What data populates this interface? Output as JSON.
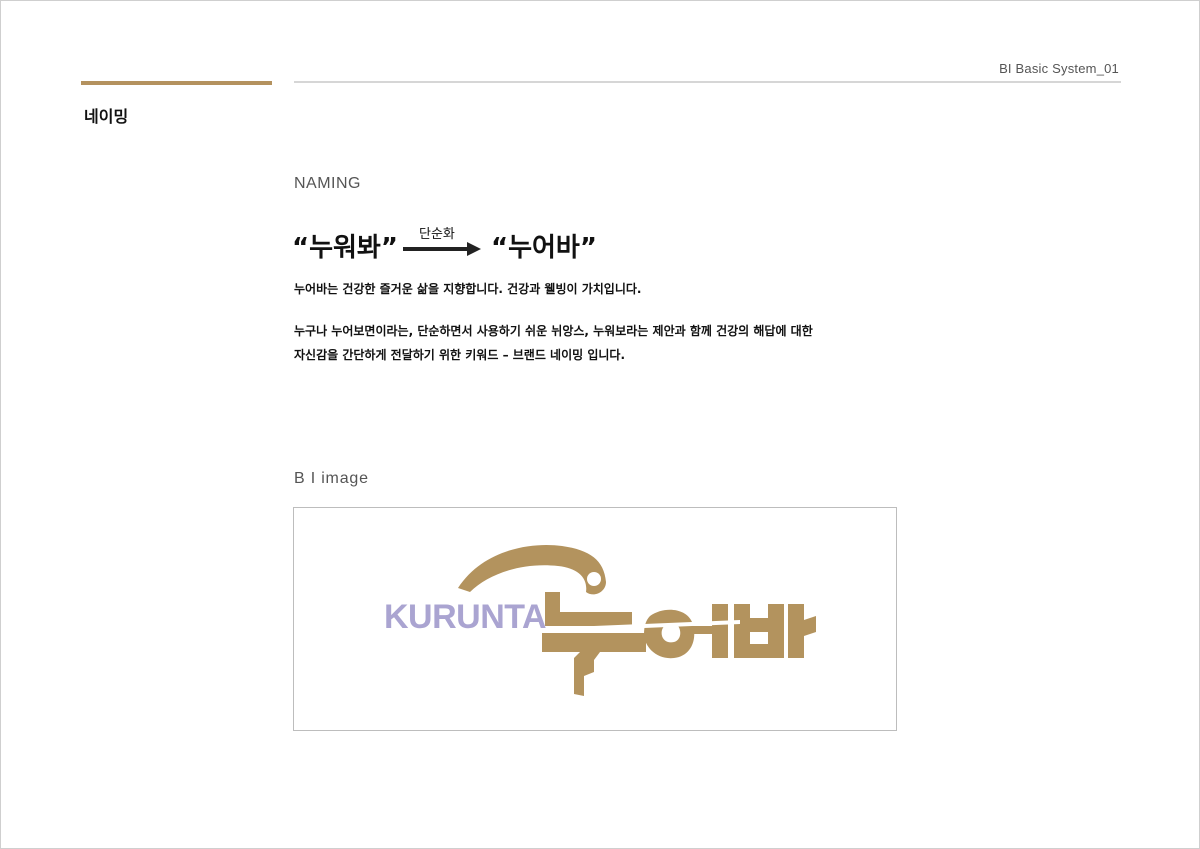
{
  "header": {
    "system_label": "BI Basic System_01",
    "section_title": "네이밍"
  },
  "naming": {
    "label": "NAMING",
    "original_word": "“누워봐”",
    "arrow_caption": "단순화",
    "simplified_word": "“누어바”",
    "paragraph1": "누어바는 건강한 즐거운 삶을 지향합니다. 건강과 웰빙이 가치입니다.",
    "paragraph2_line1": "누구나 누어보면이라는, 단순하면서 사용하기 쉬운 뉘앙스, 누워보라는 제안과 함께 건강의 해답에 대한",
    "paragraph2_line2": "자신감을 간단하게 전달하기 위한 키워드 – 브랜드 네이밍 입니다."
  },
  "bi": {
    "label": "B I  image",
    "logo_text_en": "KURUNTA",
    "logo_lettering_ko": "누어바"
  },
  "colors": {
    "accent_gold": "#b4925f",
    "logo_gold": "#b3935e",
    "logo_purple": "#aaa4d1",
    "text": "#111111",
    "muted_text": "#555555",
    "rule_gray": "#d6d6d6"
  }
}
